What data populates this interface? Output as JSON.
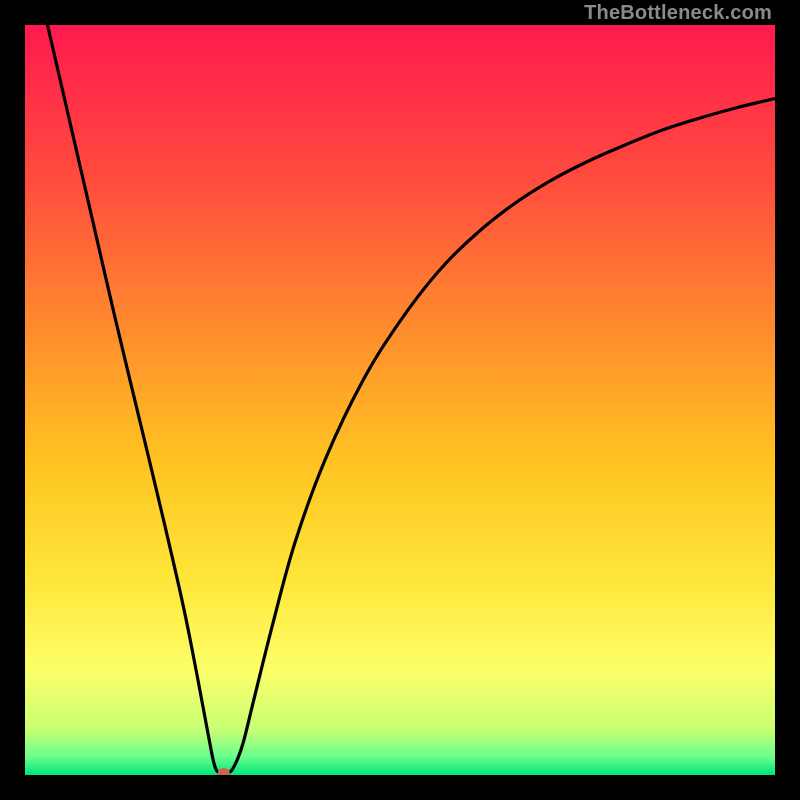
{
  "watermark": "TheBottleneck.com",
  "chart_data": {
    "type": "line",
    "title": "",
    "xlabel": "",
    "ylabel": "",
    "xlim": [
      0,
      100
    ],
    "ylim": [
      0,
      100
    ],
    "background_gradient": {
      "stops": [
        {
          "pos": 0.0,
          "color": "#ff1a4e"
        },
        {
          "pos": 0.2,
          "color": "#ff4a3e"
        },
        {
          "pos": 0.4,
          "color": "#ff8a2e"
        },
        {
          "pos": 0.58,
          "color": "#ffc321"
        },
        {
          "pos": 0.74,
          "color": "#ffe63a"
        },
        {
          "pos": 0.86,
          "color": "#fdff69"
        },
        {
          "pos": 0.94,
          "color": "#c7ff74"
        },
        {
          "pos": 0.975,
          "color": "#6bff8c"
        },
        {
          "pos": 1.0,
          "color": "#00e57a"
        }
      ]
    },
    "marker": {
      "x": 26.5,
      "y": 0,
      "color": "#d0624f",
      "rx": 6,
      "ry": 5
    },
    "series": [
      {
        "name": "bottleneck-curve",
        "color": "#000000",
        "points": [
          {
            "x": 3.0,
            "y": 100.0
          },
          {
            "x": 6.0,
            "y": 87.0
          },
          {
            "x": 9.0,
            "y": 74.0
          },
          {
            "x": 12.0,
            "y": 61.0
          },
          {
            "x": 15.0,
            "y": 48.5
          },
          {
            "x": 18.0,
            "y": 36.0
          },
          {
            "x": 21.0,
            "y": 23.0
          },
          {
            "x": 23.0,
            "y": 13.0
          },
          {
            "x": 24.5,
            "y": 5.0
          },
          {
            "x": 25.3,
            "y": 1.2
          },
          {
            "x": 26.0,
            "y": 0.3
          },
          {
            "x": 27.0,
            "y": 0.3
          },
          {
            "x": 27.8,
            "y": 1.0
          },
          {
            "x": 29.0,
            "y": 4.0
          },
          {
            "x": 30.5,
            "y": 10.0
          },
          {
            "x": 33.0,
            "y": 20.0
          },
          {
            "x": 36.0,
            "y": 31.0
          },
          {
            "x": 40.0,
            "y": 42.0
          },
          {
            "x": 45.0,
            "y": 52.5
          },
          {
            "x": 50.0,
            "y": 60.5
          },
          {
            "x": 55.0,
            "y": 67.0
          },
          {
            "x": 60.0,
            "y": 72.0
          },
          {
            "x": 65.0,
            "y": 76.0
          },
          {
            "x": 70.0,
            "y": 79.2
          },
          {
            "x": 75.0,
            "y": 81.8
          },
          {
            "x": 80.0,
            "y": 84.0
          },
          {
            "x": 85.0,
            "y": 86.0
          },
          {
            "x": 90.0,
            "y": 87.6
          },
          {
            "x": 95.0,
            "y": 89.0
          },
          {
            "x": 100.0,
            "y": 90.2
          }
        ]
      }
    ]
  }
}
